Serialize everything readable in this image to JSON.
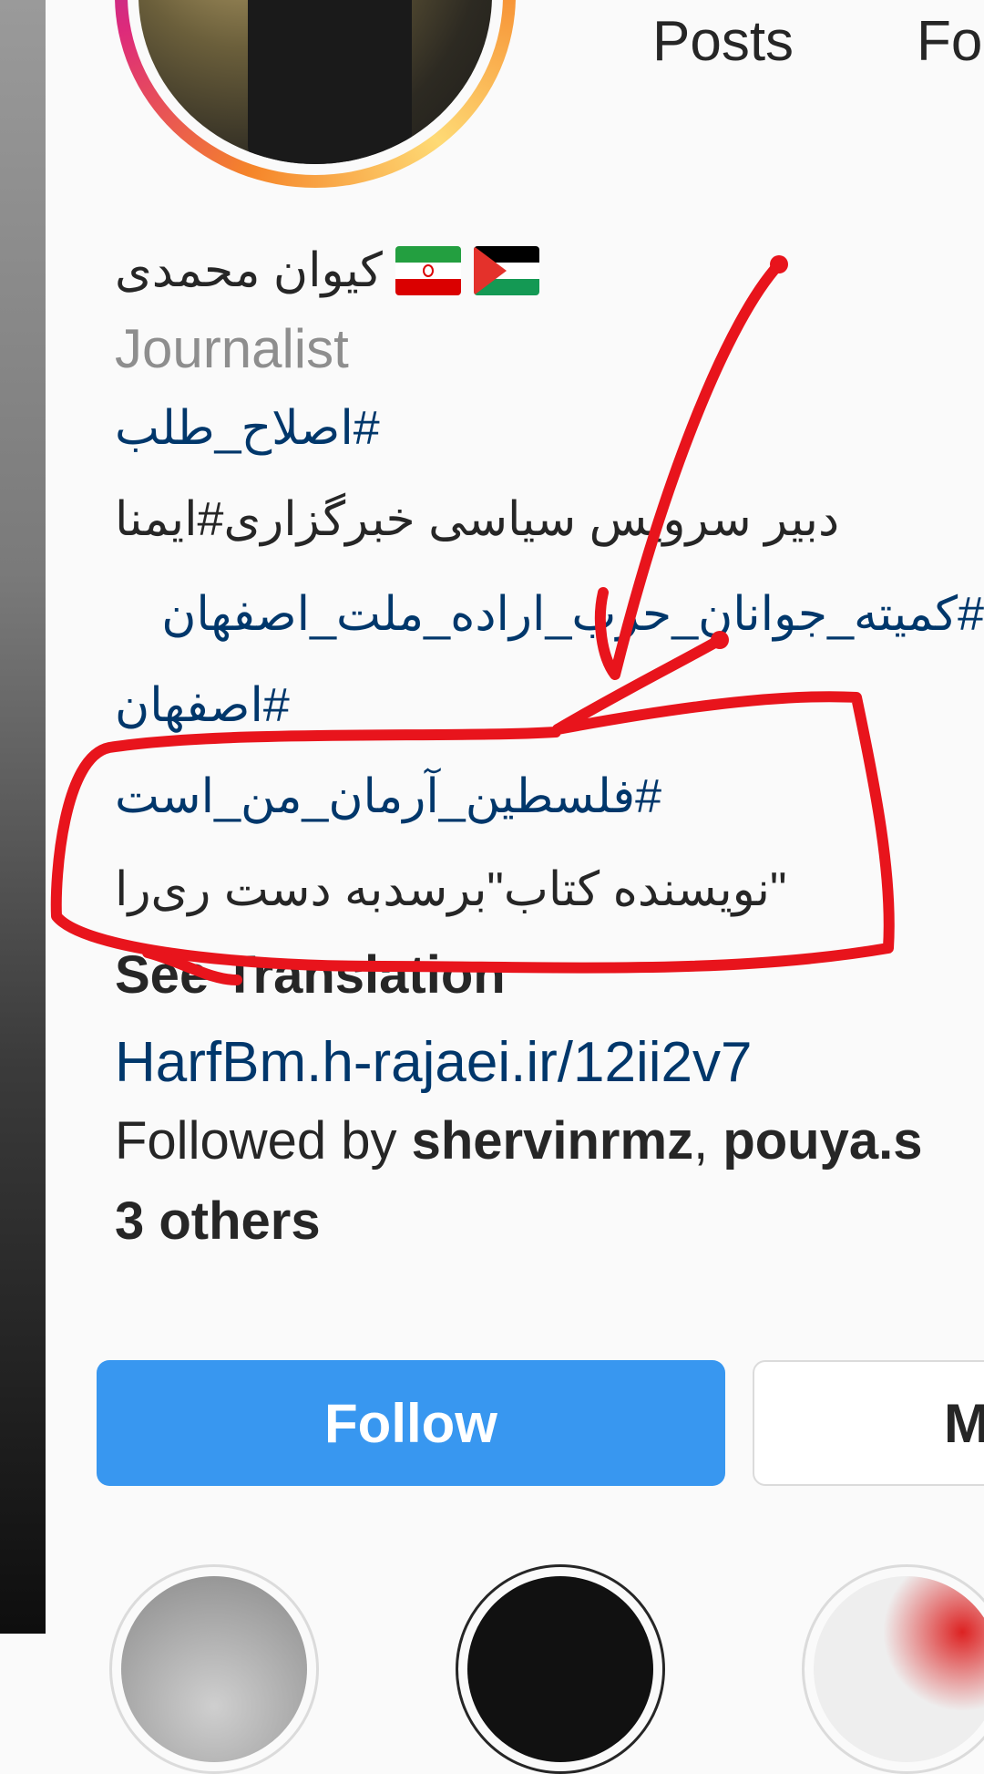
{
  "header": {
    "stats": [
      {
        "label": "Posts"
      },
      {
        "label": "Fo"
      }
    ]
  },
  "profile": {
    "display_name": "کیوان محمدی",
    "category": "Journalist",
    "bio_lines": [
      {
        "text": "#اصلاح_طلب",
        "type": "hashtag"
      },
      {
        "text": "دبیر سرویس سیاسی خبرگزاری#ایمنا",
        "type": "mixed"
      },
      {
        "text": "#کمیته_جوانان_حزب_اراده_ملت_اصفهان",
        "type": "hashtag"
      },
      {
        "text": "#اصفهان",
        "type": "hashtag"
      },
      {
        "text": "#فلسطین_آرمان_من_است",
        "type": "hashtag"
      },
      {
        "text": "\"نویسنده کتاب\"برسدبه دست ری‌را",
        "type": "plain"
      }
    ],
    "see_translation": "See Translation",
    "website": "HarfBm.h-rajaei.ir/12ii2v7",
    "followed_by_prefix": "Followed by ",
    "followed_by_users": "shervinrmz",
    "followed_by_sep": ", ",
    "followed_by_users2": "pouya.s",
    "followed_by_others": "3 others"
  },
  "actions": {
    "follow_label": "Follow",
    "message_label": "M"
  },
  "colors": {
    "link": "#00376b",
    "follow_button": "#3897f0",
    "annotation": "#e8141c"
  }
}
